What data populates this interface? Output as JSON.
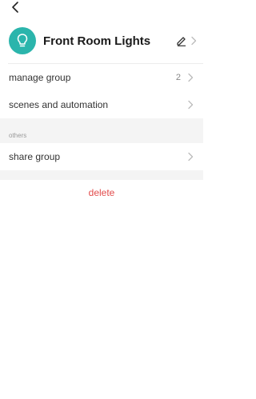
{
  "header": {
    "title": "Front Room Lights",
    "icon_color": "#2bb5ac",
    "icon": "lightbulb-icon"
  },
  "groups": {
    "manage": {
      "label": "manage group",
      "count": "2"
    },
    "scenes": {
      "label": "scenes and automation"
    }
  },
  "others": {
    "section_label": "others",
    "share": {
      "label": "share group"
    }
  },
  "actions": {
    "delete_label": "delete",
    "delete_color": "#e24b4b"
  }
}
